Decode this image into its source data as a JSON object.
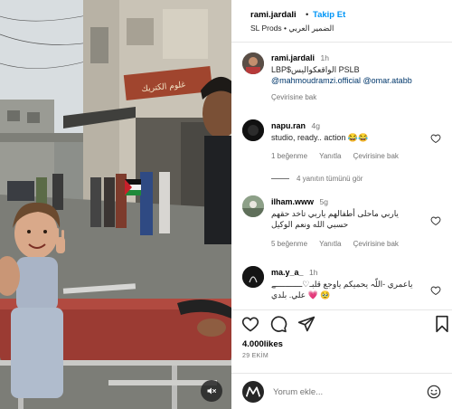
{
  "post": {
    "username": "rami.jardali",
    "follow_label": "Takip Et",
    "separator": "•",
    "audio": "SL Prods • الضمير العربي",
    "caption": {
      "username": "rami.jardali",
      "time": "1h",
      "text_line1": "LBP$الواقعكواليس PSLB",
      "mention1": "@mahmoudramzi.official",
      "mention2": "@omar.atabb",
      "translate_label": "Çevirisine bak"
    }
  },
  "comments": [
    {
      "username": "napu.ran",
      "time": "4g",
      "text": "studio, ready.. action 😂😂",
      "likes_label": "1 beğenme",
      "reply_label": "Yanıtla",
      "translate_label": "Çevirisine bak",
      "view_replies": "4 yanıtın tümünü gör"
    },
    {
      "username": "ilham.www",
      "time": "5g",
      "text_line1": "ياربي ماحلى أطفالهم ياربي تاخد حقهم",
      "text_line2": "حسبي الله ونعم الوكيل",
      "likes_label": "5 beğenme",
      "reply_label": "Yanıtla",
      "translate_label": "Çevirisine bak"
    },
    {
      "username": "ma.y_a_",
      "time": "1h",
      "text_line1": "ياعمري -اللّہ يحميكم ياوجع قلبـ♡ـــــــــــے",
      "text_line2": "علي. بلدي 💗 🥹"
    }
  ],
  "actions": {
    "like_icon": "heart-outline-icon",
    "comment_icon": "comment-bubble-icon",
    "share_icon": "paper-plane-icon",
    "save_icon": "bookmark-icon"
  },
  "likes": "4.000likes",
  "date": "29 EKİM",
  "composer": {
    "placeholder": "Yorum ekle...",
    "emoji_icon": "emoji-smile-icon"
  },
  "media": {
    "sign_text": "غلوم الكتريك",
    "mute_icon": "muted-speaker-icon"
  },
  "colors": {
    "accent": "#0095f6",
    "link": "#00376b",
    "muted": "#737373",
    "text": "#262626"
  }
}
